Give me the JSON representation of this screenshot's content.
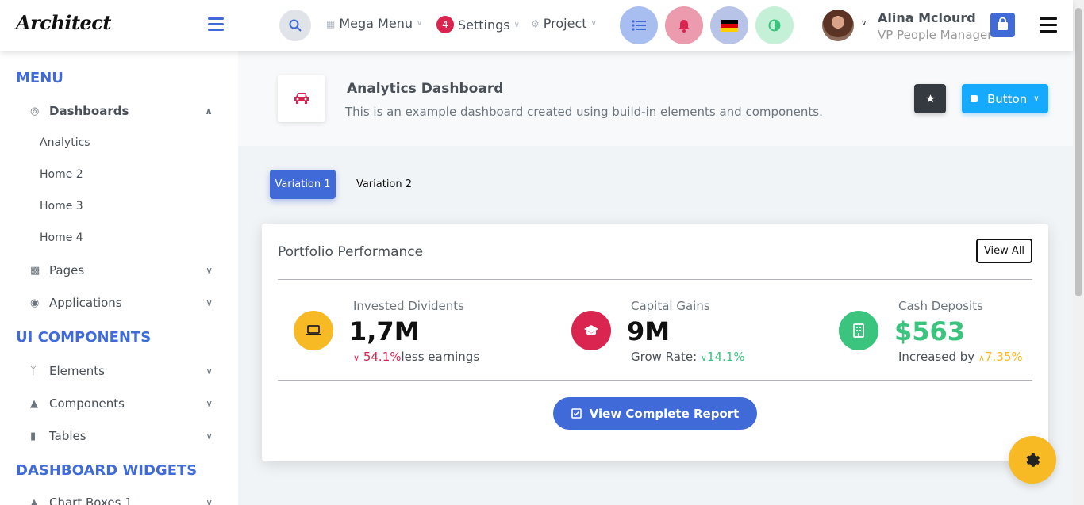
{
  "app": {
    "logo": "Architect"
  },
  "header": {
    "mega_menu": "Mega Menu",
    "settings": "Settings",
    "settings_badge": "4",
    "project": "Project",
    "user_name": "Alina Mclourd",
    "user_role": "VP People Manager",
    "colors": {
      "list": "#a8bdf0",
      "bell": "#ec9aae",
      "flag": "#b8c3e8",
      "contrast": "#c5f0d8"
    }
  },
  "sidebar": {
    "section_menu": "MENU",
    "section_ui": "UI COMPONENTS",
    "section_widgets": "DASHBOARD WIDGETS",
    "dashboards": "Dashboards",
    "sub": [
      "Analytics",
      "Home 2",
      "Home 3",
      "Home 4"
    ],
    "pages": "Pages",
    "applications": "Applications",
    "elements": "Elements",
    "components": "Components",
    "tables": "Tables",
    "chart_boxes": "Chart Boxes 1"
  },
  "page": {
    "title": "Analytics Dashboard",
    "subtitle": "This is an example dashboard created using build-in elements and components.",
    "button": "Button"
  },
  "tabs": [
    "Variation 1",
    "Variation 2"
  ],
  "card": {
    "title": "Portfolio Performance",
    "view_all": "View All",
    "metrics": [
      {
        "label": "Invested Dividents",
        "value": "1,7M",
        "change": "54.1%",
        "suffix": "less earnings",
        "color": "#f7b924"
      },
      {
        "label": "Capital Gains",
        "value": "9M",
        "prefix": "Grow Rate:",
        "change": "14.1%",
        "color": "#d92550"
      },
      {
        "label": "Cash Deposits",
        "value": "$563",
        "prefix": "Increased by",
        "change": "7.35%",
        "color": "#3ac47d"
      }
    ],
    "report_button": "View Complete Report"
  }
}
